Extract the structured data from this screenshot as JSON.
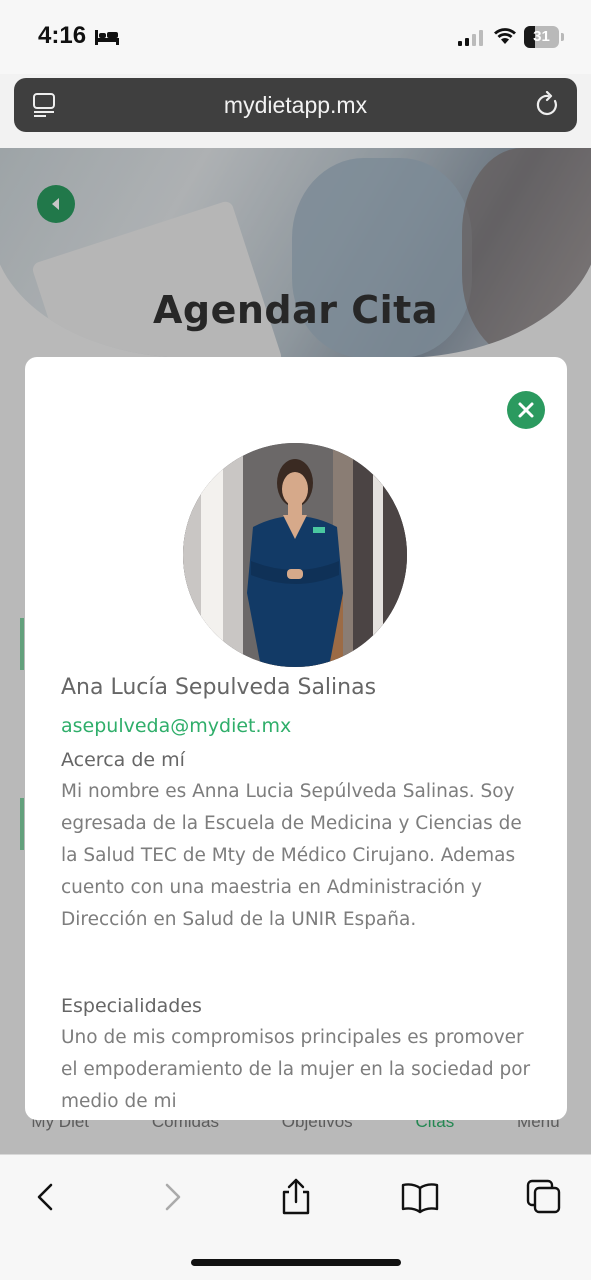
{
  "status_bar": {
    "time": "4:16",
    "battery_level": "31",
    "battery_fraction": 0.31
  },
  "browser": {
    "url": "mydietapp.mx"
  },
  "page": {
    "hero_title": "Agendar Cita",
    "nav_items": [
      "My Diet",
      "Comidas",
      "Objetivos",
      "Citas",
      "Menú"
    ],
    "active_nav_index": 3
  },
  "modal": {
    "name": "Ana Lucía Sepulveda Salinas",
    "email": "asepulveda@mydiet.mx",
    "about_heading": "Acerca de mí",
    "about_text": "Mi nombre es Anna Lucia Sepúlveda Salinas. Soy egresada de la Escuela de Medicina y Ciencias de la Salud TEC de Mty de Médico Cirujano. Ademas cuento con una maestria en Administración y Dirección en Salud de la UNIR España.",
    "specialties_heading": "Especialidades",
    "specialties_text": "Uno de mis compromisos principales es promover el empoderamiento de la mujer en la sociedad por medio de mi"
  },
  "colors": {
    "accent": "#2b9a5f",
    "email": "#2fae6a",
    "address_bar": "#3f3f3f"
  },
  "icons": {
    "close": "close-icon",
    "back": "chevron-left-icon",
    "share": "share-icon",
    "bookmarks": "book-icon",
    "tabs": "tabs-icon",
    "reload": "reload-icon"
  }
}
